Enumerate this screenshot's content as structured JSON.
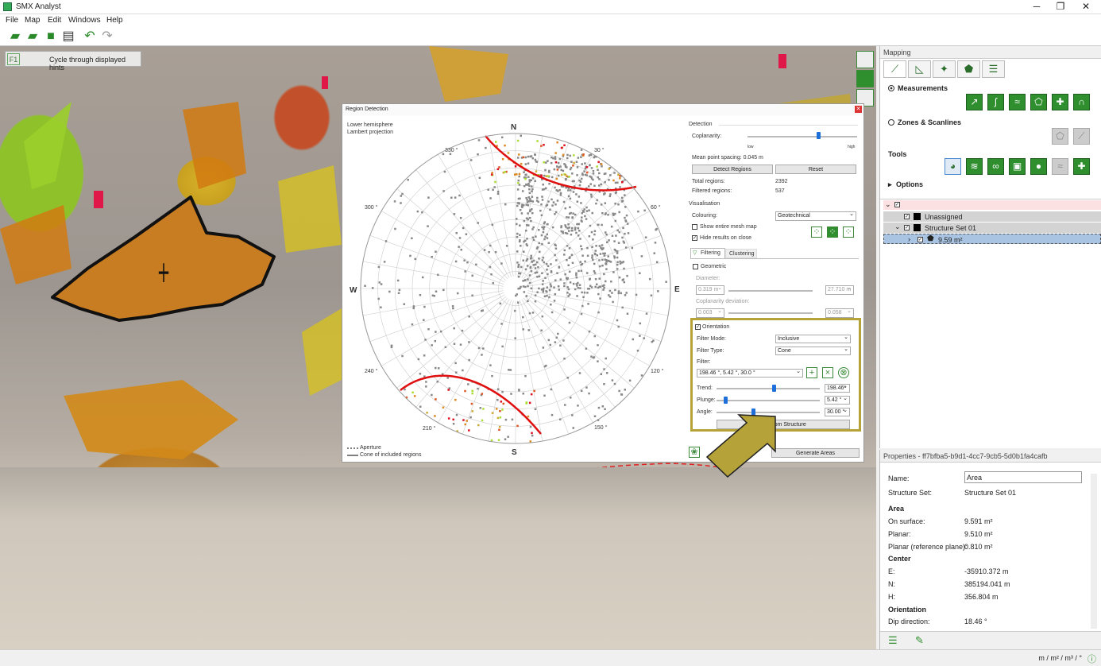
{
  "window": {
    "title": "SMX Analyst",
    "min": "─",
    "max": "❐",
    "close": "✕"
  },
  "menu": [
    "File",
    "Map",
    "Edit",
    "Windows",
    "Help"
  ],
  "hint": {
    "key": "F1",
    "text": "Cycle through displayed hints"
  },
  "dialog": {
    "title": "Region Detection",
    "stereo": {
      "line1": "Lower hemisphere",
      "line2": "Lambert projection",
      "N": "N",
      "S": "S",
      "E": "E",
      "W": "W",
      "angles": [
        "330 °",
        "30 °",
        "300 °",
        "60 °",
        "240 °",
        "120 °",
        "210 °",
        "150 °"
      ],
      "legend_aperture": "Aperture",
      "legend_cone": "Cone of included regions"
    },
    "detection": {
      "header": "Detection",
      "coplanarity": "Coplanarity:",
      "low": "low",
      "high": "high",
      "spacing": "Mean point spacing: 0.045 m",
      "detect_btn": "Detect Regions",
      "reset_btn": "Reset",
      "total_label": "Total regions:",
      "total": "2392",
      "filtered_label": "Filtered regions:",
      "filtered": "537"
    },
    "visualisation": {
      "header": "Visualisation",
      "colouring_label": "Colouring:",
      "colouring": "Geotechnical",
      "show_mesh": "Show entire mesh map",
      "hide_results": "Hide results on close"
    },
    "tabs": {
      "filtering": "Filtering",
      "clustering": "Clustering"
    },
    "geometric": {
      "label": "Geometric",
      "diameter": "Diameter:",
      "dmin": "0.319 m",
      "dmax": "27.710 m",
      "copdev": "Coplanarity deviation:",
      "cmin": "0.003",
      "cmax": "0.058"
    },
    "orientation": {
      "label": "Orientation",
      "filter_mode_label": "Filter Mode:",
      "filter_mode": "Inclusive",
      "filter_type_label": "Filter Type:",
      "filter_type": "Cone",
      "filter_label": "Filter:",
      "filter_value": "198.46 °, 5.42 °, 30.0 °",
      "trend_label": "Trend:",
      "trend": "198.46°",
      "plunge_label": "Plunge:",
      "plunge": "5.42 °",
      "angle_label": "Angle:",
      "angle": "30.00 °",
      "get_btn": "Get from Structure"
    },
    "generate_btn": "Generate Areas"
  },
  "mapping": {
    "title": "Mapping",
    "measurements": "Measurements",
    "zones": "Zones & Scanlines",
    "tools": "Tools",
    "options": "Options"
  },
  "tree": {
    "unassigned": "Unassigned",
    "structure_set": "Structure Set 01",
    "item": "9.59 m²"
  },
  "properties": {
    "title": "Properties - ff7bfba5-b9d1-4cc7-9cb5-5d0b1fa4cafb",
    "name_label": "Name:",
    "name": "Area",
    "set_label": "Structure Set:",
    "set": "Structure Set 01",
    "area_header": "Area",
    "on_surface_label": "On surface:",
    "on_surface": "9.591 m²",
    "planar_label": "Planar:",
    "planar": "9.510 m²",
    "planar_ref_label": "Planar (reference plane):",
    "planar_ref": "0.810 m²",
    "center_header": "Center",
    "e_label": "E:",
    "e": "-35910.372 m",
    "n_label": "N:",
    "n": "385194.041 m",
    "h_label": "H:",
    "h": "356.804 m",
    "orient_header": "Orientation",
    "dip_dir_label": "Dip direction:",
    "dip_dir": "18.46 °"
  },
  "status": {
    "units": "m / m² / m³ / °"
  }
}
